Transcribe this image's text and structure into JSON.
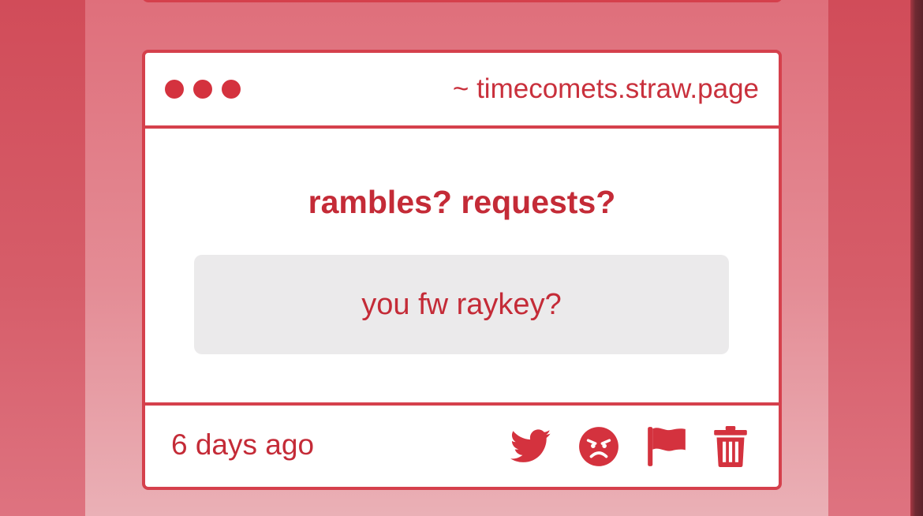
{
  "card": {
    "header_url": "~ timecomets.straw.page",
    "question": "rambles? requests?",
    "answer": "you fw raykey?",
    "timestamp": "6 days ago"
  },
  "actions": [
    {
      "icon": "twitter-bird-icon"
    },
    {
      "icon": "angry-face-icon"
    },
    {
      "icon": "flag-icon"
    },
    {
      "icon": "trash-icon"
    }
  ],
  "colors": {
    "accent": "#c42b37",
    "border": "#d5404c",
    "answer_bg": "#ebeaeb"
  }
}
